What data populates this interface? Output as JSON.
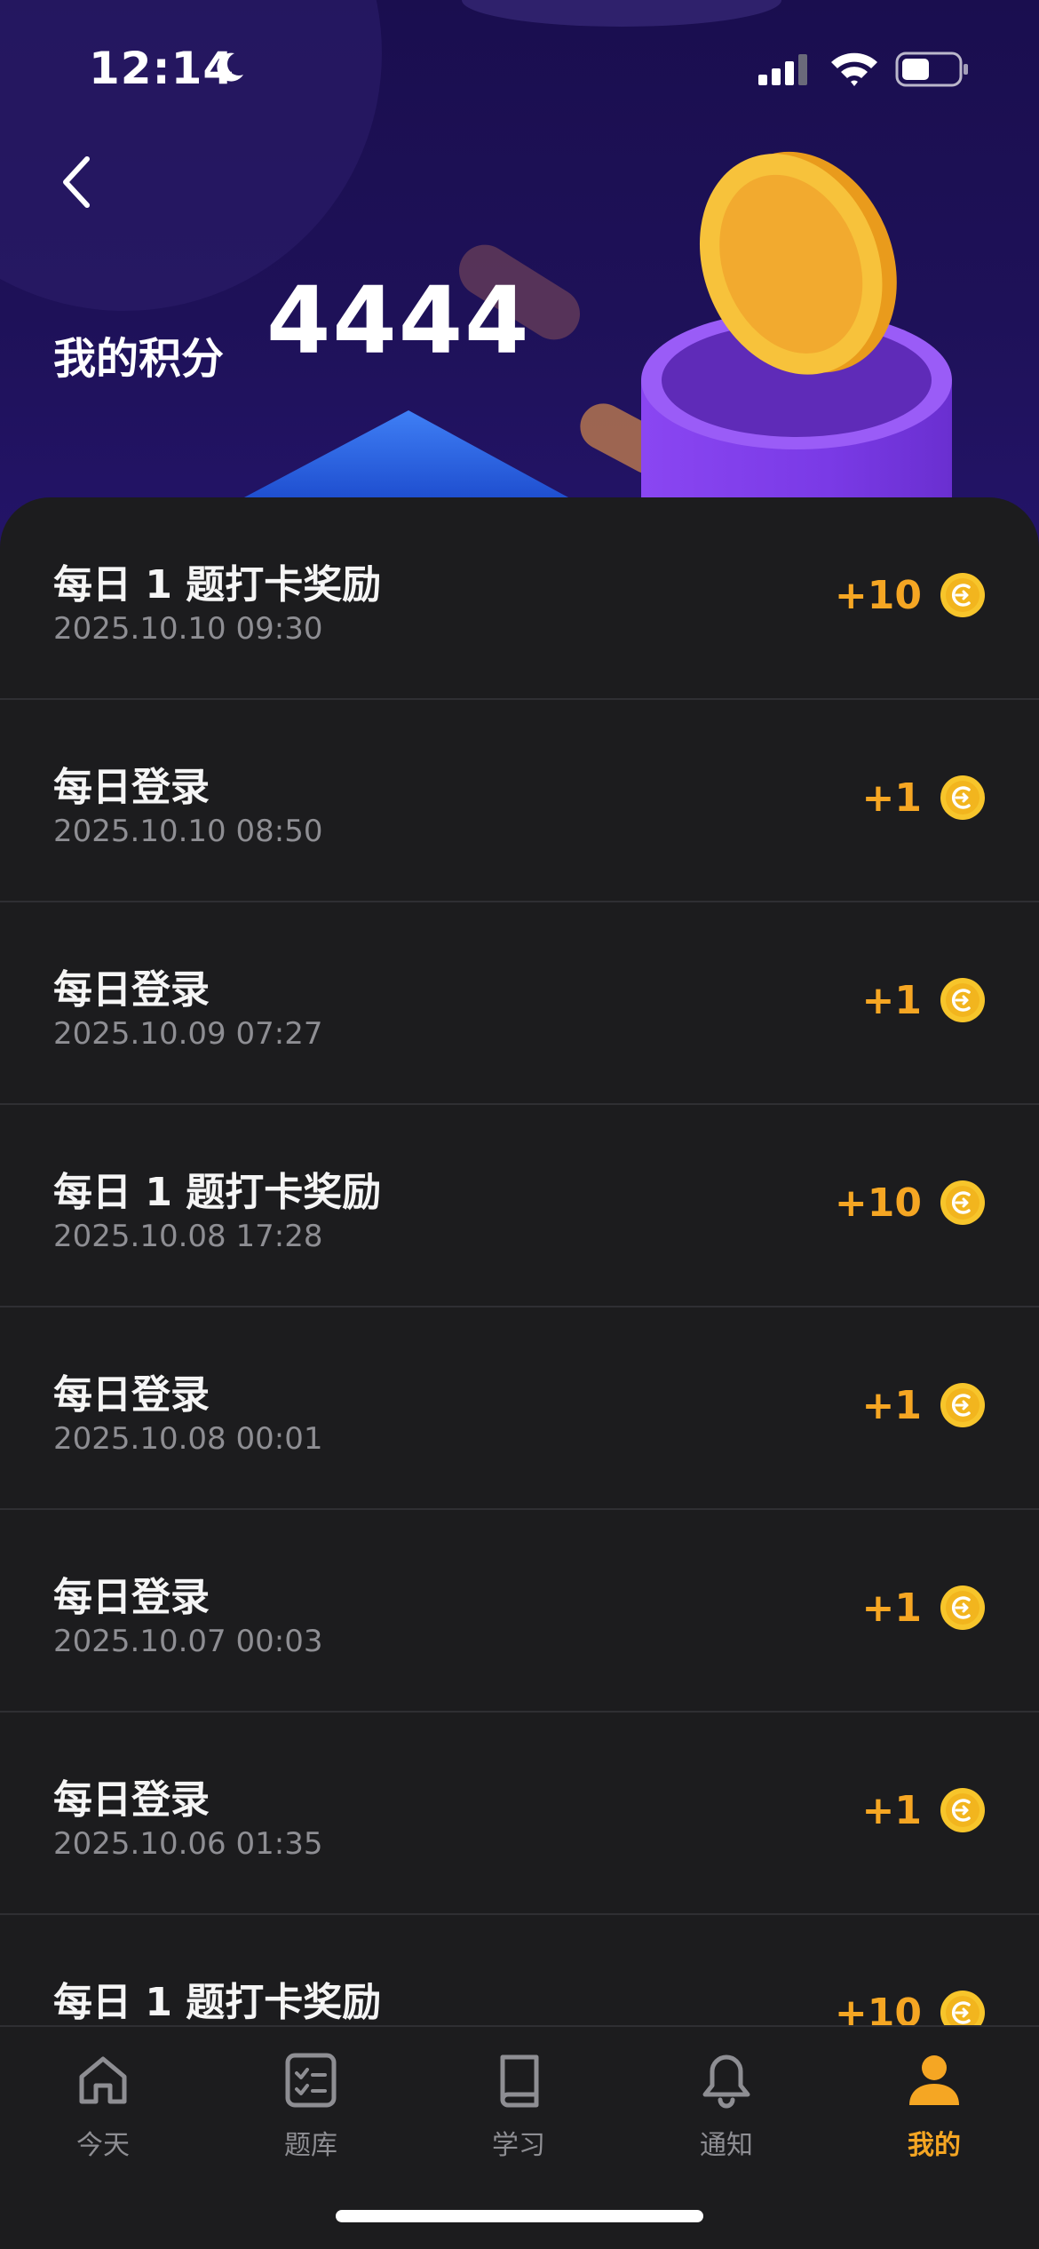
{
  "status_bar": {
    "time": "12:14"
  },
  "header": {
    "points_label": "我的积分",
    "points_value": "4444"
  },
  "records": [
    {
      "title": "每日 1 题打卡奖励",
      "date": "2025.10.10 09:30",
      "amount": "+10"
    },
    {
      "title": "每日登录",
      "date": "2025.10.10 08:50",
      "amount": "+1"
    },
    {
      "title": "每日登录",
      "date": "2025.10.09 07:27",
      "amount": "+1"
    },
    {
      "title": "每日 1 题打卡奖励",
      "date": "2025.10.08 17:28",
      "amount": "+10"
    },
    {
      "title": "每日登录",
      "date": "2025.10.08 00:01",
      "amount": "+1"
    },
    {
      "title": "每日登录",
      "date": "2025.10.07 00:03",
      "amount": "+1"
    },
    {
      "title": "每日登录",
      "date": "2025.10.06 01:35",
      "amount": "+1"
    },
    {
      "title": "每日 1 题打卡奖励",
      "date": "",
      "amount": "+10"
    }
  ],
  "tab_bar": {
    "tabs": [
      {
        "label": "今天",
        "icon": "home-icon"
      },
      {
        "label": "题库",
        "icon": "checklist-icon"
      },
      {
        "label": "学习",
        "icon": "book-icon"
      },
      {
        "label": "通知",
        "icon": "bell-icon"
      },
      {
        "label": "我的",
        "icon": "person-icon",
        "active": true
      }
    ]
  },
  "colors": {
    "accent": "#f5a623",
    "hero_background": "#1e1158",
    "list_background": "#1c1c1e",
    "secondary_text": "#8e8e93"
  }
}
